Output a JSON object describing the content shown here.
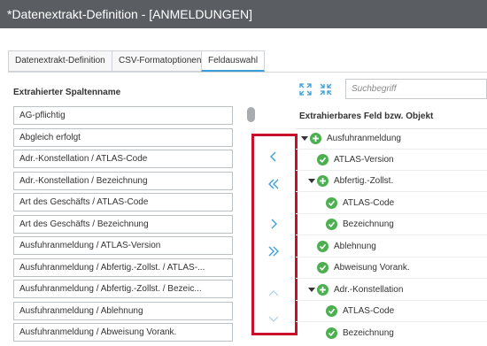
{
  "window": {
    "title": "*Datenextrakt-Definition - [ANMELDUNGEN]"
  },
  "tabs": [
    {
      "label": "Datenextrakt-Definition",
      "active": false
    },
    {
      "label": "CSV-Formatoptionen",
      "active": false
    },
    {
      "label": "Feldauswahl",
      "active": true
    }
  ],
  "left_panel": {
    "header": "Extrahierter Spaltenname",
    "items": [
      "AG-pflichtig",
      "Abgleich erfolgt",
      "Adr.-Konstellation / ATLAS-Code",
      "Adr.-Konstellation / Bezeichnung",
      "Art des Geschäfts / ATLAS-Code",
      "Art des Geschäfts / Bezeichnung",
      "Ausfuhranmeldung / ATLAS-Version",
      "Ausfuhranmeldung / Abfertig.-Zollst. / ATLAS-...",
      "Ausfuhranmeldung / Abfertig.-Zollst. / Bezeic...",
      "Ausfuhranmeldung / Ablehnung",
      "Ausfuhranmeldung / Abweisung Vorank."
    ]
  },
  "transfer_buttons": [
    {
      "name": "move-left",
      "icon": "chevron-left-icon"
    },
    {
      "name": "move-all-left",
      "icon": "double-chevron-left-icon"
    },
    {
      "name": "move-right",
      "icon": "chevron-right-icon"
    },
    {
      "name": "move-all-right",
      "icon": "double-chevron-right-icon"
    },
    {
      "name": "move-up",
      "icon": "chevron-up-icon"
    },
    {
      "name": "move-down",
      "icon": "chevron-down-icon"
    }
  ],
  "right_panel": {
    "toolbar": {
      "expand_icon": "expand-all-icon",
      "collapse_icon": "collapse-all-icon"
    },
    "search": {
      "placeholder": "Suchbegriff"
    },
    "header": "Extrahierbares Feld bzw. Objekt",
    "tree": [
      {
        "label": "Ausfuhranmeldung",
        "type": "group",
        "level": 0
      },
      {
        "label": "ATLAS-Version",
        "type": "field",
        "level": 1
      },
      {
        "label": "Abfertig.-Zollst.",
        "type": "group",
        "level": 1
      },
      {
        "label": "ATLAS-Code",
        "type": "field",
        "level": 2
      },
      {
        "label": "Bezeichnung",
        "type": "field",
        "level": 2
      },
      {
        "label": "Ablehnung",
        "type": "field",
        "level": 1
      },
      {
        "label": "Abweisung Vorank.",
        "type": "field",
        "level": 1
      },
      {
        "label": "Adr.-Konstellation",
        "type": "group",
        "level": 1
      },
      {
        "label": "ATLAS-Code",
        "type": "field",
        "level": 2
      },
      {
        "label": "Bezeichnung",
        "type": "field",
        "level": 2
      }
    ]
  },
  "colors": {
    "accent": "#3a9fd6",
    "titlebar": "#5a5e63",
    "success": "#4caf50",
    "highlight_border": "#c8102e"
  }
}
